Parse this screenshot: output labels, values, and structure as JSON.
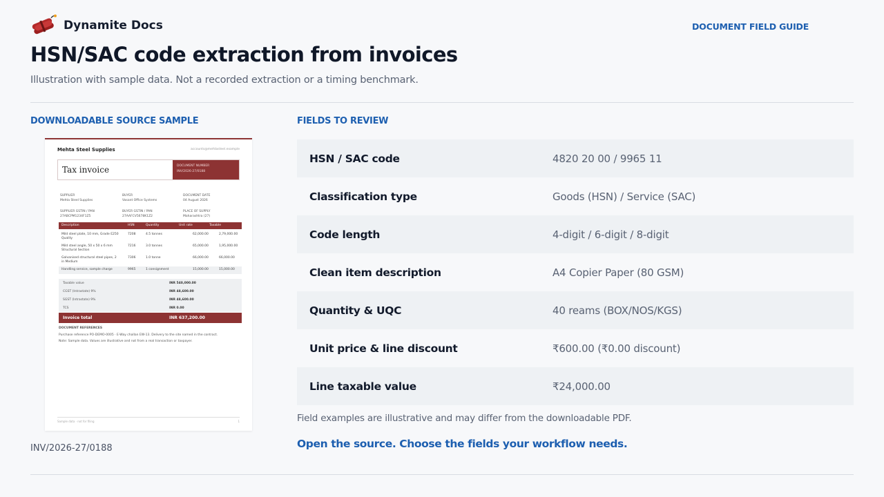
{
  "brand": {
    "name": "Dynamite Docs",
    "logo_icon": "dynamite-icon"
  },
  "header": {
    "guide_link": "DOCUMENT FIELD GUIDE"
  },
  "page": {
    "title": "HSN/SAC code extraction from invoices",
    "subtitle": "Illustration with sample data. Not a recorded extraction or a timing benchmark."
  },
  "source": {
    "label": "DOWNLOADABLE SOURCE SAMPLE",
    "invoice_number": "INV/2026-27/0188"
  },
  "preview": {
    "seller": "Mehta Steel Supplies",
    "contact": "accounts@mehtasteel.example",
    "doc_title": "Tax invoice",
    "doc_no_label": "DOCUMENT NUMBER",
    "doc_no": "INV/2026-27/0188",
    "supplier_label": "SUPPLIER",
    "supplier": "Mehta Steel Supplies",
    "buyer_label": "BUYER",
    "buyer": "Vasant Office Systems",
    "date_label": "DOCUMENT DATE",
    "date": "04 August 2026",
    "supplier_gstin_label": "SUPPLIER GSTIN / PAN",
    "supplier_gstin": "27ABCPM1234F1Z5",
    "buyer_gstin_label": "BUYER GSTIN / PAN",
    "buyer_gstin": "27AAFCV5678K1Z2",
    "pos_label": "PLACE OF SUPPLY",
    "pos": "Maharashtra (27)",
    "headers": [
      "Description",
      "HSN",
      "Quantity",
      "Unit rate",
      "Taxable"
    ],
    "rows": [
      {
        "desc": "Mild steel plate, 10 mm, Grade E250 Quality",
        "hsn": "7208",
        "qty": "4.5 tonnes",
        "rate": "62,000.00",
        "taxable": "2,79,000.00"
      },
      {
        "desc": "Mild steel angle, 50 x 50 x 6 mm Structural Section",
        "hsn": "7216",
        "qty": "3.0 tonnes",
        "rate": "65,000.00",
        "taxable": "1,95,000.00"
      },
      {
        "desc": "Galvanised structural steel pipes, 2 in Medium",
        "hsn": "7306",
        "qty": "1.0 tonne",
        "rate": "66,000.00",
        "taxable": "66,000.00"
      },
      {
        "desc": "Handling service, sample charge",
        "hsn": "9965",
        "qty": "1 consignment",
        "rate": "15,000.00",
        "taxable": "15,000.00"
      }
    ],
    "totals": [
      {
        "label": "Taxable value",
        "value": "INR 540,000.00"
      },
      {
        "label": "CGST (Intrastate) 9%",
        "value": "INR 48,600.00"
      },
      {
        "label": "SGST (Intrastate) 9%",
        "value": "INR 48,600.00"
      },
      {
        "label": "TCS",
        "value": "INR 0.00"
      }
    ],
    "grand_label": "Invoice total",
    "grand_value": "INR 637,200.00",
    "ref_label": "DOCUMENT REFERENCES",
    "ref_line1": "Purchase reference PO-DEMO-0005 · E-Way challan EW-13. Delivery to the site named in the contract.",
    "ref_line2": "Note: Sample data. Values are illustrative and not from a real transaction or taxpayer.",
    "footer_left": "Sample data · not for filing",
    "footer_page": "1"
  },
  "fields_section": {
    "label": "FIELDS TO REVIEW",
    "rows": [
      {
        "name": "HSN / SAC code",
        "value": "4820 20 00 / 9965 11"
      },
      {
        "name": "Classification type",
        "value": "Goods (HSN) / Service (SAC)"
      },
      {
        "name": "Code length",
        "value": "4-digit / 6-digit / 8-digit"
      },
      {
        "name": "Clean item description",
        "value": "A4 Copier Paper (80 GSM)"
      },
      {
        "name": "Quantity & UQC",
        "value": "40 reams (BOX/NOS/KGS)"
      },
      {
        "name": "Unit price & line discount",
        "value": "₹600.00 (₹0.00 discount)"
      },
      {
        "name": "Line taxable value",
        "value": "₹24,000.00"
      }
    ],
    "note": "Field examples are illustrative and may differ from the downloadable PDF.",
    "cta": "Open the source. Choose the fields your workflow needs."
  },
  "colors": {
    "accent": "#1d5fb0",
    "invoice_red": "#8d3333",
    "row_shade": "#eef1f4"
  }
}
